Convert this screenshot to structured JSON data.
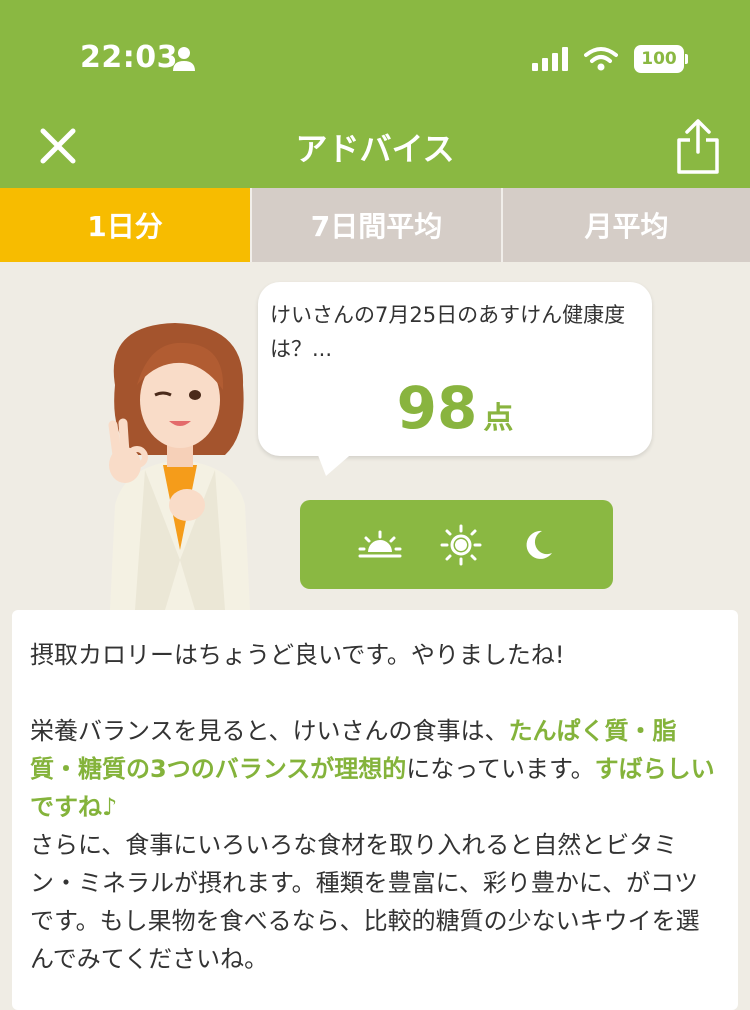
{
  "status": {
    "time": "22:03",
    "battery": "100"
  },
  "header": {
    "title": "アドバイス"
  },
  "tabs": [
    {
      "label": "1日分"
    },
    {
      "label": "7日間平均"
    },
    {
      "label": "月平均"
    }
  ],
  "bubble": {
    "text": "けいさんの7月25日のあすけん健康度は？...",
    "score": "98",
    "unit": "点"
  },
  "meal_icons": [
    "sunrise-icon",
    "sun-icon",
    "moon-icon"
  ],
  "advice": {
    "line1": "摂取カロリーはちょうど良いです。やりましたね!",
    "p2_a": "栄養バランスを見ると、けいさんの食事は、",
    "p2_b": "たんぱく質・脂質・糖質の3つのバランスが理想的",
    "p2_c": "になっています。",
    "p2_d": "すばらしいですね♪",
    "p3": "さらに、食事にいろいろな食材を取り入れると自然とビタミン・ミネラルが摂れます。種類を豊富に、彩り豊かに、がコツです。もし果物を食べるなら、比較的糖質の少ないキウイを選んでみてくださいね。"
  },
  "colors": {
    "brand_green": "#8ab842",
    "active_tab": "#f7bc00",
    "inactive_tab": "#d5cdc7",
    "score_green": "#89b43f"
  }
}
